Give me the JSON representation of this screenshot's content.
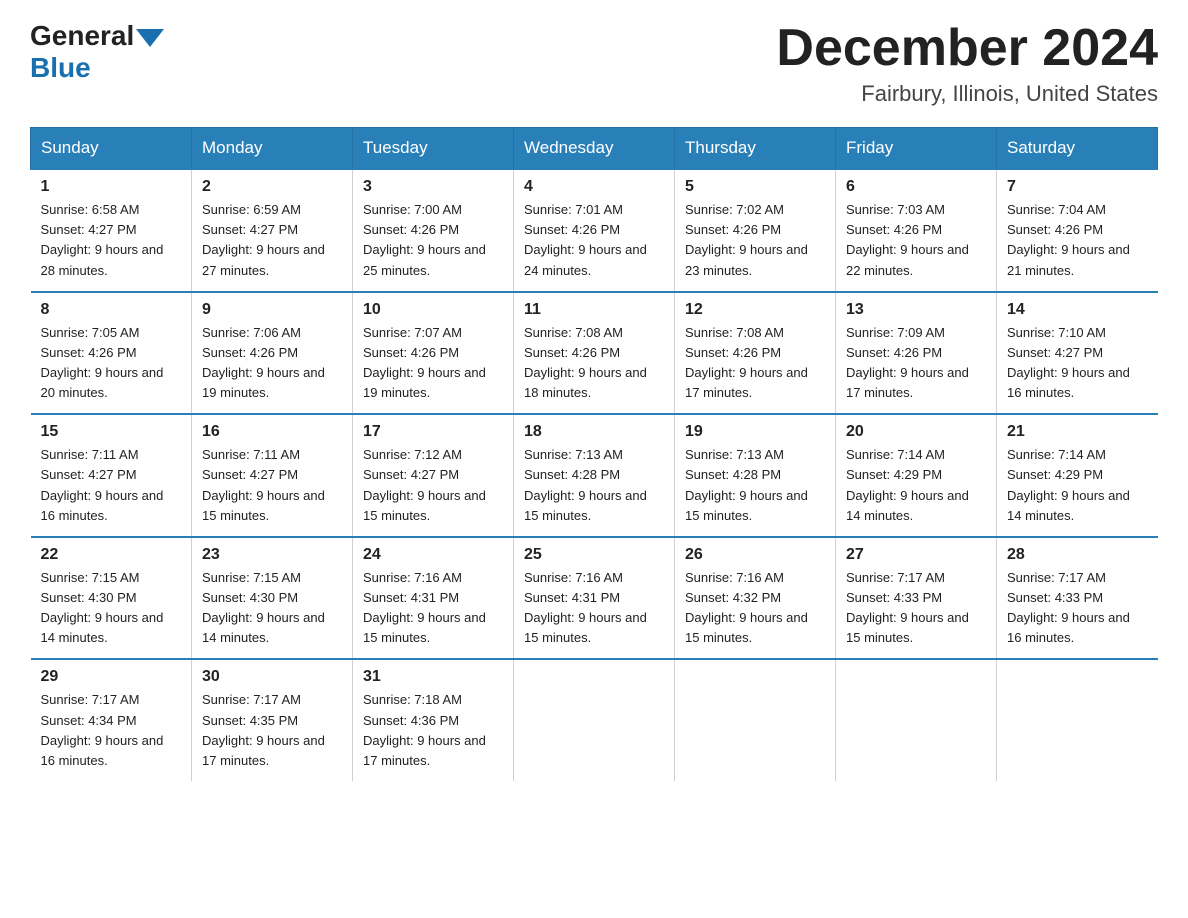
{
  "logo": {
    "general": "General",
    "blue": "Blue"
  },
  "header": {
    "month": "December 2024",
    "location": "Fairbury, Illinois, United States"
  },
  "weekdays": [
    "Sunday",
    "Monday",
    "Tuesday",
    "Wednesday",
    "Thursday",
    "Friday",
    "Saturday"
  ],
  "weeks": [
    [
      {
        "day": "1",
        "sunrise": "6:58 AM",
        "sunset": "4:27 PM",
        "daylight": "9 hours and 28 minutes."
      },
      {
        "day": "2",
        "sunrise": "6:59 AM",
        "sunset": "4:27 PM",
        "daylight": "9 hours and 27 minutes."
      },
      {
        "day": "3",
        "sunrise": "7:00 AM",
        "sunset": "4:26 PM",
        "daylight": "9 hours and 25 minutes."
      },
      {
        "day": "4",
        "sunrise": "7:01 AM",
        "sunset": "4:26 PM",
        "daylight": "9 hours and 24 minutes."
      },
      {
        "day": "5",
        "sunrise": "7:02 AM",
        "sunset": "4:26 PM",
        "daylight": "9 hours and 23 minutes."
      },
      {
        "day": "6",
        "sunrise": "7:03 AM",
        "sunset": "4:26 PM",
        "daylight": "9 hours and 22 minutes."
      },
      {
        "day": "7",
        "sunrise": "7:04 AM",
        "sunset": "4:26 PM",
        "daylight": "9 hours and 21 minutes."
      }
    ],
    [
      {
        "day": "8",
        "sunrise": "7:05 AM",
        "sunset": "4:26 PM",
        "daylight": "9 hours and 20 minutes."
      },
      {
        "day": "9",
        "sunrise": "7:06 AM",
        "sunset": "4:26 PM",
        "daylight": "9 hours and 19 minutes."
      },
      {
        "day": "10",
        "sunrise": "7:07 AM",
        "sunset": "4:26 PM",
        "daylight": "9 hours and 19 minutes."
      },
      {
        "day": "11",
        "sunrise": "7:08 AM",
        "sunset": "4:26 PM",
        "daylight": "9 hours and 18 minutes."
      },
      {
        "day": "12",
        "sunrise": "7:08 AM",
        "sunset": "4:26 PM",
        "daylight": "9 hours and 17 minutes."
      },
      {
        "day": "13",
        "sunrise": "7:09 AM",
        "sunset": "4:26 PM",
        "daylight": "9 hours and 17 minutes."
      },
      {
        "day": "14",
        "sunrise": "7:10 AM",
        "sunset": "4:27 PM",
        "daylight": "9 hours and 16 minutes."
      }
    ],
    [
      {
        "day": "15",
        "sunrise": "7:11 AM",
        "sunset": "4:27 PM",
        "daylight": "9 hours and 16 minutes."
      },
      {
        "day": "16",
        "sunrise": "7:11 AM",
        "sunset": "4:27 PM",
        "daylight": "9 hours and 15 minutes."
      },
      {
        "day": "17",
        "sunrise": "7:12 AM",
        "sunset": "4:27 PM",
        "daylight": "9 hours and 15 minutes."
      },
      {
        "day": "18",
        "sunrise": "7:13 AM",
        "sunset": "4:28 PM",
        "daylight": "9 hours and 15 minutes."
      },
      {
        "day": "19",
        "sunrise": "7:13 AM",
        "sunset": "4:28 PM",
        "daylight": "9 hours and 15 minutes."
      },
      {
        "day": "20",
        "sunrise": "7:14 AM",
        "sunset": "4:29 PM",
        "daylight": "9 hours and 14 minutes."
      },
      {
        "day": "21",
        "sunrise": "7:14 AM",
        "sunset": "4:29 PM",
        "daylight": "9 hours and 14 minutes."
      }
    ],
    [
      {
        "day": "22",
        "sunrise": "7:15 AM",
        "sunset": "4:30 PM",
        "daylight": "9 hours and 14 minutes."
      },
      {
        "day": "23",
        "sunrise": "7:15 AM",
        "sunset": "4:30 PM",
        "daylight": "9 hours and 14 minutes."
      },
      {
        "day": "24",
        "sunrise": "7:16 AM",
        "sunset": "4:31 PM",
        "daylight": "9 hours and 15 minutes."
      },
      {
        "day": "25",
        "sunrise": "7:16 AM",
        "sunset": "4:31 PM",
        "daylight": "9 hours and 15 minutes."
      },
      {
        "day": "26",
        "sunrise": "7:16 AM",
        "sunset": "4:32 PM",
        "daylight": "9 hours and 15 minutes."
      },
      {
        "day": "27",
        "sunrise": "7:17 AM",
        "sunset": "4:33 PM",
        "daylight": "9 hours and 15 minutes."
      },
      {
        "day": "28",
        "sunrise": "7:17 AM",
        "sunset": "4:33 PM",
        "daylight": "9 hours and 16 minutes."
      }
    ],
    [
      {
        "day": "29",
        "sunrise": "7:17 AM",
        "sunset": "4:34 PM",
        "daylight": "9 hours and 16 minutes."
      },
      {
        "day": "30",
        "sunrise": "7:17 AM",
        "sunset": "4:35 PM",
        "daylight": "9 hours and 17 minutes."
      },
      {
        "day": "31",
        "sunrise": "7:18 AM",
        "sunset": "4:36 PM",
        "daylight": "9 hours and 17 minutes."
      },
      null,
      null,
      null,
      null
    ]
  ]
}
